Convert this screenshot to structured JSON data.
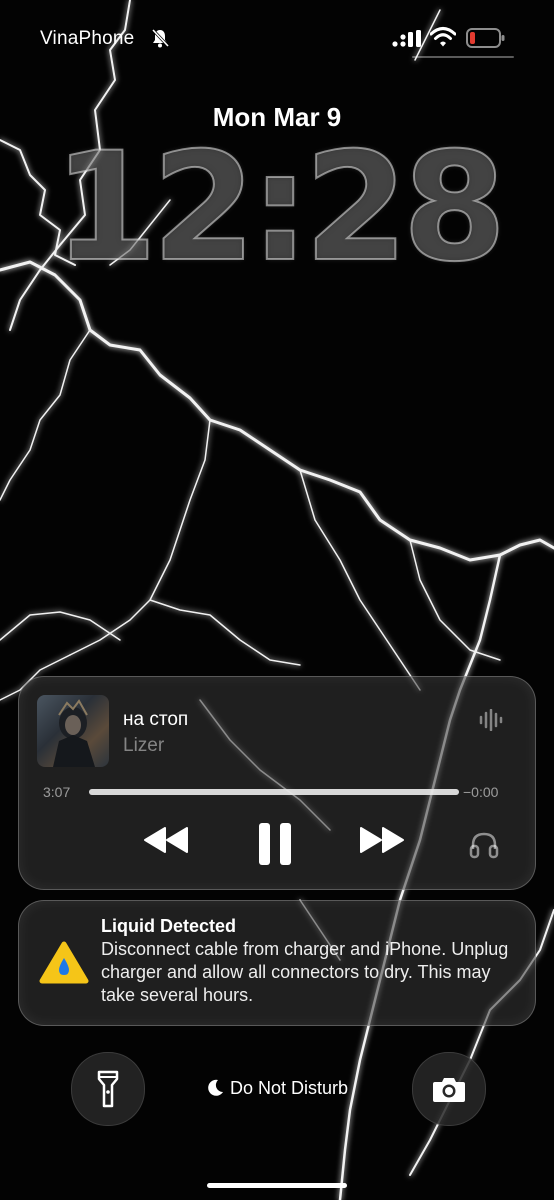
{
  "status_bar": {
    "carrier": "VinaPhone",
    "battery_color": "#e33b30"
  },
  "lock_screen": {
    "date": "Mon Mar 9",
    "time": "12:28"
  },
  "now_playing": {
    "title": "на стоп",
    "artist": "Lizer",
    "elapsed": "3:07",
    "remaining": "−0:00",
    "progress": 1.0
  },
  "notification": {
    "title": "Liquid Detected",
    "body": "Disconnect cable from charger and iPhone. Unplug charger and allow all connectors to dry. This may take several hours.",
    "icon_color": "#f5c518"
  },
  "bottom_bar": {
    "focus_mode": "Do Not Disturb"
  }
}
